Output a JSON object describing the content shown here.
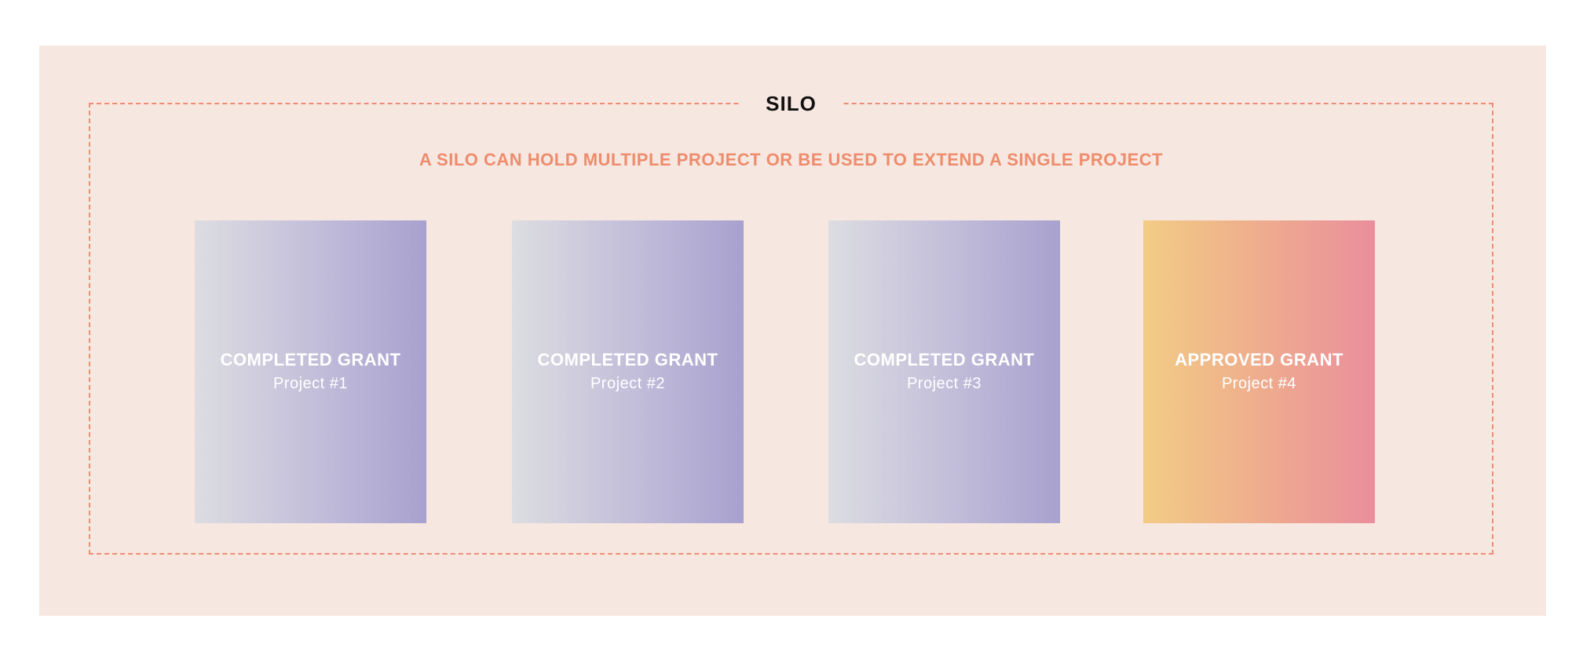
{
  "silo": {
    "title": "SILO",
    "description": "A SILO CAN HOLD MULTIPLE PROJECT OR BE USED TO EXTEND A SINGLE PROJECT"
  },
  "cards": [
    {
      "status": "COMPLETED GRANT",
      "project": "Project #1"
    },
    {
      "status": "COMPLETED GRANT",
      "project": "Project #2"
    },
    {
      "status": "COMPLETED GRANT",
      "project": "Project #3"
    },
    {
      "status": "APPROVED GRANT",
      "project": "Project #4"
    }
  ],
  "colors": {
    "panel_background": "#f6e7e1",
    "frame_border": "#ee8c74",
    "subtitle_text": "#ee8c6c",
    "completed_gradient": [
      "#dcdde1",
      "#c4bfda",
      "#a8a1cf"
    ],
    "approved_gradient": [
      "#f2cc86",
      "#efb08c",
      "#ea8e9c"
    ]
  }
}
